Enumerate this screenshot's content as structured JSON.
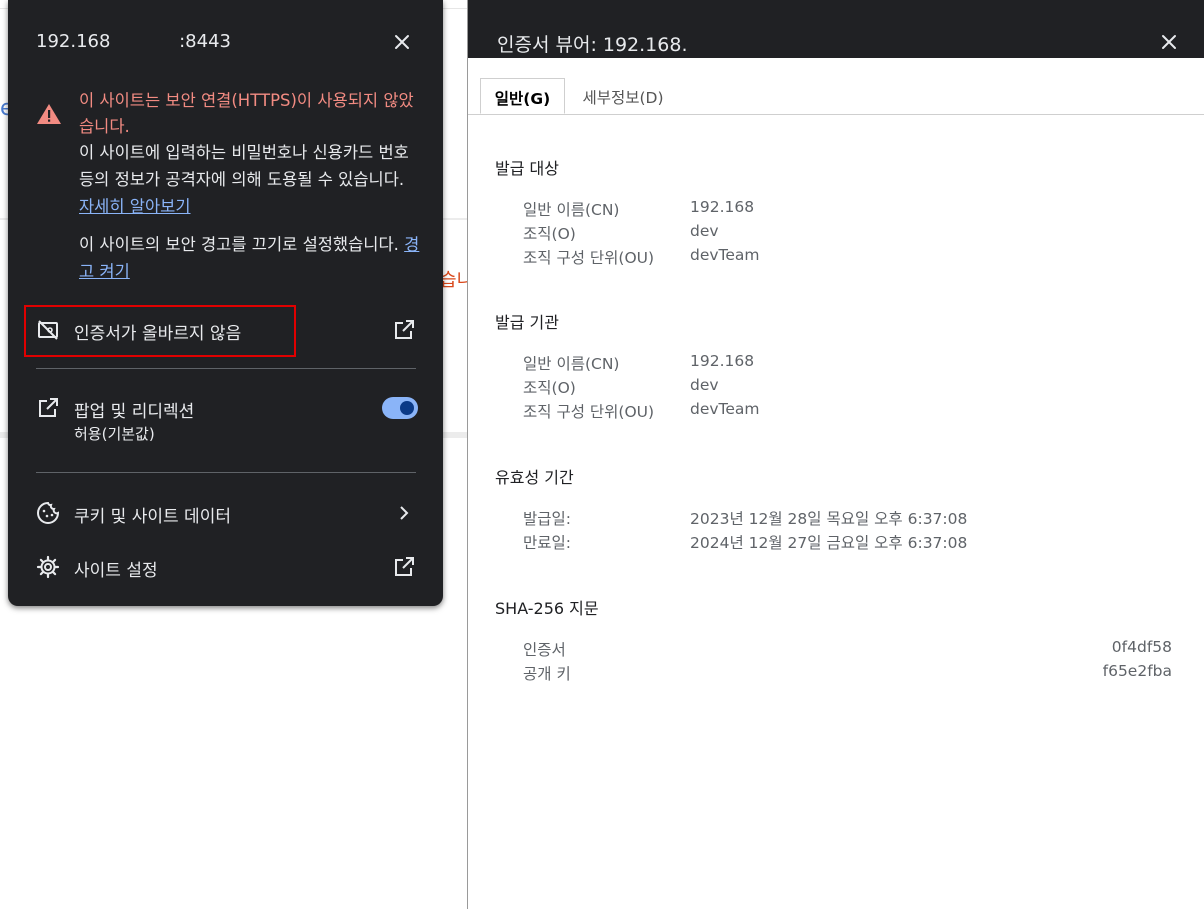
{
  "background": {
    "partial_text": "습니"
  },
  "popup": {
    "host": "192.168            :8443",
    "warning_title": "이 사이트는 보안 연결(HTTPS)이 사용되지 않았습니다.",
    "warning_body": "이 사이트에 입력하는 비밀번호나 신용카드 번호 등의 정보가 공격자에 의해 도용될 수 있습니다.",
    "learn_more_link": "자세히 알아보기",
    "warning_off_text": "이 사이트의 보안 경고를 끄기로 설정했습니다.",
    "warning_on_link": "경고 켜기",
    "cert_row_label": "인증서가 올바르지 않음",
    "popups_label": "팝업 및 리디렉션",
    "popups_sub": "허용(기본값)",
    "popups_toggle_on": true,
    "cookies_label": "쿠키 및 사이트 데이터",
    "site_settings_label": "사이트 설정"
  },
  "viewer": {
    "title": "인증서 뷰어: 192.168.",
    "tabs": [
      {
        "label": "일반(G)",
        "active": true
      },
      {
        "label": "세부정보(D)",
        "active": false
      }
    ],
    "issued_to": {
      "title": "발급 대상",
      "cn_label": "일반 이름(CN)",
      "cn": "192.168",
      "o_label": "조직(O)",
      "o": "dev",
      "ou_label": "조직 구성 단위(OU)",
      "ou": "devTeam"
    },
    "issued_by": {
      "title": "발급 기관",
      "cn_label": "일반 이름(CN)",
      "cn": "192.168",
      "o_label": "조직(O)",
      "o": "dev",
      "ou_label": "조직 구성 단위(OU)",
      "ou": "devTeam"
    },
    "validity": {
      "title": "유효성 기간",
      "issued_label": "발급일:",
      "issued": "2023년 12월 28일 목요일 오후 6:37:08",
      "expires_label": "만료일:",
      "expires": "2024년 12월 27일 금요일 오후 6:37:08"
    },
    "fingerprints": {
      "title": "SHA-256 지문",
      "cert_label": "인증서",
      "cert": "0f4df58",
      "key_label": "공개 키",
      "key": "f65e2fba"
    }
  },
  "colors": {
    "popup_bg": "#202124",
    "warning_red": "#f28b82",
    "link_blue": "#8ab4f8",
    "highlight_red": "#e00000"
  }
}
